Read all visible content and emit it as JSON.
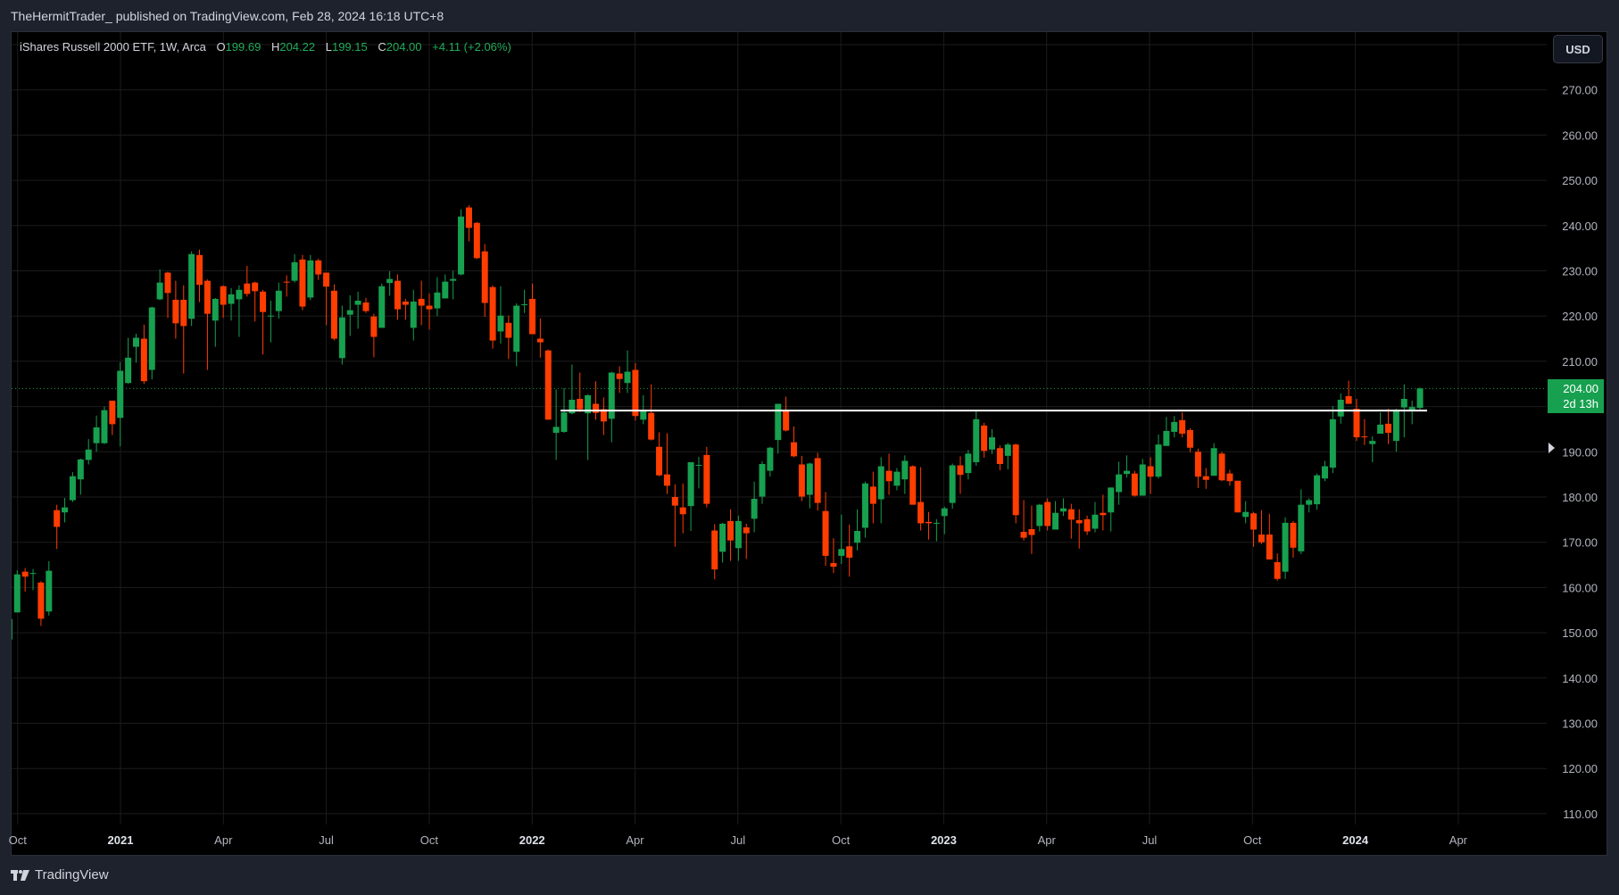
{
  "header": {
    "published": "TheHermitTrader_ published on TradingView.com, Feb 28, 2024 16:18 UTC+8"
  },
  "legend": {
    "symbol": "iShares Russell 2000 ETF, 1W, Arca",
    "o_label": "O",
    "o": "199.69",
    "h_label": "H",
    "h": "204.22",
    "l_label": "L",
    "l": "199.15",
    "c_label": "C",
    "c": "204.00",
    "change": "+4.11 (+2.06%)"
  },
  "currency_button": "USD",
  "last_price": {
    "price": "204.00",
    "countdown": "2d 13h"
  },
  "footer": {
    "brand": "TradingView"
  },
  "colors": {
    "up": "#17a04f",
    "down": "#ff3d00",
    "background": "#000000",
    "frame": "#1e222d"
  },
  "chart_data": {
    "type": "candlestick",
    "title": "iShares Russell 2000 ETF, 1W, Arca",
    "interval": "1W",
    "ylim": [
      105,
      280
    ],
    "y_ticks": [
      270,
      260,
      250,
      240,
      230,
      220,
      210,
      200,
      190,
      180,
      170,
      160,
      150,
      140,
      130,
      120,
      110
    ],
    "y_tick_labels": [
      "270.00",
      "260.00",
      "250.00",
      "240.00",
      "230.00",
      "220.00",
      "210.00",
      "200.00",
      "190.00",
      "180.00",
      "170.00",
      "160.00",
      "150.00",
      "140.00",
      "130.00",
      "120.00",
      "110.00"
    ],
    "x_labels": [
      {
        "text": "Oct",
        "major": false
      },
      {
        "text": "2021",
        "major": true
      },
      {
        "text": "Apr",
        "major": false
      },
      {
        "text": "Jul",
        "major": false
      },
      {
        "text": "Oct",
        "major": false
      },
      {
        "text": "2022",
        "major": true
      },
      {
        "text": "Apr",
        "major": false
      },
      {
        "text": "Jul",
        "major": false
      },
      {
        "text": "Oct",
        "major": false
      },
      {
        "text": "2023",
        "major": true
      },
      {
        "text": "Apr",
        "major": false
      },
      {
        "text": "Jul",
        "major": false
      },
      {
        "text": "Oct",
        "major": false
      },
      {
        "text": "2024",
        "major": true
      },
      {
        "text": "Apr",
        "major": false
      }
    ],
    "horizontal_line_level": 199.1,
    "last_price_line": 204.0,
    "ohlc_columns": [
      "open",
      "high",
      "low",
      "close"
    ],
    "ohlc": [
      [
        148.5,
        153.2,
        148.2,
        153.0
      ],
      [
        154.5,
        163.8,
        154.5,
        162.9
      ],
      [
        163.5,
        164.3,
        159.1,
        162.4
      ],
      [
        163.0,
        164.1,
        159.4,
        163.2
      ],
      [
        161.1,
        161.4,
        151.5,
        153.1
      ],
      [
        154.7,
        165.8,
        153.8,
        163.7
      ],
      [
        177.1,
        178.3,
        168.5,
        173.4
      ],
      [
        176.6,
        179.8,
        174.4,
        177.7
      ],
      [
        179.3,
        185.5,
        178.9,
        184.6
      ],
      [
        183.9,
        188.5,
        180.5,
        188.3
      ],
      [
        188.2,
        192.8,
        187.2,
        190.5
      ],
      [
        191.9,
        198.0,
        190.0,
        195.4
      ],
      [
        191.9,
        200.0,
        191.7,
        199.2
      ],
      [
        201.3,
        201.3,
        193.7,
        196.1
      ],
      [
        197.5,
        209.8,
        191.2,
        207.9
      ],
      [
        205.2,
        215.2,
        205.0,
        210.8
      ],
      [
        213.2,
        216.1,
        209.7,
        215.2
      ],
      [
        215.0,
        218.1,
        205.0,
        205.6
      ],
      [
        208.1,
        222.1,
        206.0,
        221.9
      ],
      [
        223.7,
        230.3,
        223.5,
        227.4
      ],
      [
        229.6,
        229.8,
        219.6,
        225.1
      ],
      [
        223.6,
        227.8,
        215.0,
        218.4
      ],
      [
        223.6,
        226.8,
        207.3,
        217.8
      ],
      [
        219.4,
        234.3,
        217.8,
        233.7
      ],
      [
        233.5,
        234.7,
        223.1,
        226.9
      ],
      [
        227.8,
        228.1,
        208.1,
        220.5
      ],
      [
        219.0,
        224.0,
        213.2,
        223.8
      ],
      [
        226.6,
        226.8,
        219.6,
        222.5
      ],
      [
        222.7,
        226.2,
        219.0,
        224.8
      ],
      [
        223.7,
        226.8,
        215.4,
        225.8
      ],
      [
        227.2,
        231.1,
        224.3,
        224.9
      ],
      [
        227.4,
        227.6,
        218.8,
        225.5
      ],
      [
        225.4,
        225.8,
        211.5,
        220.9
      ],
      [
        220.0,
        223.4,
        214.2,
        220.1
      ],
      [
        221.1,
        227.4,
        219.4,
        225.6
      ],
      [
        227.6,
        229.0,
        224.3,
        227.4
      ],
      [
        227.8,
        233.7,
        227.4,
        231.9
      ],
      [
        232.5,
        233.5,
        221.3,
        222.1
      ],
      [
        224.1,
        233.5,
        223.5,
        232.3
      ],
      [
        232.3,
        232.7,
        228.0,
        229.2
      ],
      [
        229.6,
        229.6,
        218.0,
        226.5
      ],
      [
        225.6,
        227.0,
        214.6,
        215.0
      ],
      [
        210.7,
        222.3,
        209.3,
        219.7
      ],
      [
        220.3,
        224.6,
        215.6,
        221.3
      ],
      [
        222.5,
        225.4,
        217.2,
        223.4
      ],
      [
        223.0,
        224.0,
        220.7,
        221.1
      ],
      [
        219.9,
        220.5,
        210.9,
        215.4
      ],
      [
        217.4,
        227.2,
        217.4,
        226.6
      ],
      [
        227.3,
        229.9,
        224.5,
        228.2
      ],
      [
        227.8,
        229.2,
        219.2,
        221.5
      ],
      [
        223.2,
        223.8,
        219.2,
        222.5
      ],
      [
        217.4,
        225.8,
        214.6,
        223.2
      ],
      [
        223.8,
        227.8,
        218.0,
        222.3
      ],
      [
        222.3,
        225.0,
        217.0,
        221.5
      ],
      [
        221.7,
        228.6,
        220.0,
        225.2
      ],
      [
        223.9,
        229.2,
        223.9,
        227.6
      ],
      [
        227.8,
        230.0,
        223.7,
        228.2
      ],
      [
        229.2,
        243.6,
        229.0,
        242.0
      ],
      [
        244.0,
        244.5,
        236.5,
        239.5
      ],
      [
        240.6,
        240.8,
        232.6,
        232.8
      ],
      [
        234.3,
        235.9,
        219.8,
        222.9
      ],
      [
        226.4,
        226.8,
        212.8,
        214.6
      ],
      [
        216.6,
        226.6,
        213.9,
        220.1
      ],
      [
        218.5,
        220.1,
        210.5,
        215.2
      ],
      [
        212.1,
        222.8,
        208.9,
        222.3
      ],
      [
        222.5,
        225.8,
        220.7,
        222.6
      ],
      [
        223.8,
        227.2,
        216.0,
        216.0
      ],
      [
        215.0,
        219.5,
        210.8,
        214.2
      ],
      [
        212.4,
        212.6,
        197.1,
        197.1
      ],
      [
        194.2,
        203.8,
        188.2,
        195.5
      ],
      [
        194.4,
        204.1,
        194.2,
        198.7
      ],
      [
        198.5,
        209.3,
        198.3,
        201.5
      ],
      [
        201.7,
        207.5,
        198.8,
        199.4
      ],
      [
        198.5,
        202.7,
        188.2,
        202.5
      ],
      [
        200.6,
        205.6,
        197.1,
        198.6
      ],
      [
        199.4,
        202.0,
        193.7,
        196.7
      ],
      [
        197.3,
        207.7,
        192.1,
        207.5
      ],
      [
        207.3,
        208.9,
        203.0,
        206.1
      ],
      [
        205.2,
        212.4,
        203.0,
        207.7
      ],
      [
        208.1,
        209.6,
        196.9,
        197.9
      ],
      [
        197.1,
        202.5,
        196.1,
        199.2
      ],
      [
        198.6,
        204.9,
        192.5,
        192.7
      ],
      [
        191.1,
        194.3,
        184.6,
        184.8
      ],
      [
        185.0,
        194.1,
        180.7,
        182.5
      ],
      [
        180.0,
        182.8,
        169.0,
        178.1
      ],
      [
        177.7,
        183.0,
        172.0,
        176.2
      ],
      [
        178.0,
        187.7,
        172.5,
        187.7
      ],
      [
        187.0,
        188.9,
        181.9,
        187.1
      ],
      [
        189.3,
        191.1,
        177.7,
        178.5
      ],
      [
        172.6,
        174.0,
        161.8,
        164.0
      ],
      [
        167.9,
        174.3,
        165.5,
        174.1
      ],
      [
        174.7,
        177.3,
        165.9,
        170.4
      ],
      [
        168.7,
        175.9,
        165.9,
        174.7
      ],
      [
        173.3,
        174.1,
        166.3,
        172.0
      ],
      [
        175.2,
        183.4,
        172.2,
        179.6
      ],
      [
        180.1,
        187.9,
        178.5,
        187.3
      ],
      [
        185.8,
        191.1,
        184.5,
        190.9
      ],
      [
        192.6,
        200.6,
        189.6,
        200.6
      ],
      [
        199.0,
        202.2,
        194.5,
        194.7
      ],
      [
        192.1,
        195.6,
        188.8,
        189.0
      ],
      [
        187.2,
        189.1,
        179.1,
        180.1
      ],
      [
        180.5,
        187.6,
        177.5,
        187.4
      ],
      [
        188.6,
        189.8,
        177.0,
        178.7
      ],
      [
        176.9,
        181.1,
        164.8,
        167.0
      ],
      [
        165.4,
        170.9,
        163.2,
        164.6
      ],
      [
        167.0,
        176.1,
        165.2,
        168.5
      ],
      [
        169.1,
        173.9,
        162.4,
        166.6
      ],
      [
        169.9,
        177.3,
        168.2,
        172.5
      ],
      [
        173.2,
        183.4,
        171.0,
        183.0
      ],
      [
        182.3,
        185.6,
        174.2,
        178.5
      ],
      [
        179.5,
        188.8,
        174.2,
        186.8
      ],
      [
        185.8,
        189.6,
        180.5,
        183.5
      ],
      [
        182.5,
        186.4,
        181.5,
        185.6
      ],
      [
        183.9,
        189.2,
        180.7,
        188.0
      ],
      [
        186.8,
        187.0,
        178.3,
        178.3
      ],
      [
        178.9,
        186.6,
        172.6,
        174.2
      ],
      [
        174.5,
        176.7,
        170.6,
        174.2
      ],
      [
        174.2,
        175.1,
        170.2,
        174.3
      ],
      [
        175.8,
        177.9,
        171.8,
        177.5
      ],
      [
        178.7,
        187.4,
        177.4,
        187.0
      ],
      [
        187.0,
        189.0,
        180.7,
        184.9
      ],
      [
        185.3,
        190.4,
        183.9,
        189.6
      ],
      [
        187.7,
        199.3,
        186.9,
        197.2
      ],
      [
        195.8,
        196.4,
        188.7,
        190.2
      ],
      [
        190.5,
        195.0,
        189.5,
        193.2
      ],
      [
        190.8,
        191.4,
        185.9,
        187.3
      ],
      [
        189.1,
        192.0,
        186.1,
        191.6
      ],
      [
        191.6,
        191.8,
        174.2,
        176.0
      ],
      [
        172.3,
        179.3,
        170.4,
        171.0
      ],
      [
        172.9,
        178.1,
        167.4,
        171.6
      ],
      [
        173.6,
        178.5,
        172.4,
        178.3
      ],
      [
        178.9,
        179.7,
        172.6,
        173.6
      ],
      [
        172.8,
        179.1,
        172.8,
        176.5
      ],
      [
        176.8,
        179.7,
        175.8,
        177.5
      ],
      [
        177.3,
        178.5,
        170.8,
        175.0
      ],
      [
        174.9,
        177.3,
        168.6,
        174.2
      ],
      [
        175.1,
        175.9,
        171.6,
        172.4
      ],
      [
        173.0,
        178.9,
        172.2,
        176.1
      ],
      [
        176.5,
        180.5,
        172.6,
        176.0
      ],
      [
        176.6,
        182.1,
        172.4,
        182.1
      ],
      [
        181.1,
        187.8,
        178.3,
        185.0
      ],
      [
        185.1,
        189.2,
        184.3,
        185.8
      ],
      [
        185.2,
        185.8,
        180.1,
        180.3
      ],
      [
        180.3,
        188.4,
        180.3,
        187.2
      ],
      [
        186.8,
        188.8,
        180.7,
        184.5
      ],
      [
        184.5,
        193.8,
        184.1,
        191.6
      ],
      [
        191.3,
        197.7,
        191.3,
        194.6
      ],
      [
        194.4,
        197.9,
        193.2,
        196.6
      ],
      [
        197.0,
        198.7,
        193.2,
        194.0
      ],
      [
        194.8,
        195.2,
        189.9,
        190.9
      ],
      [
        190.0,
        190.7,
        182.0,
        184.5
      ],
      [
        184.6,
        186.4,
        181.8,
        183.8
      ],
      [
        184.7,
        191.9,
        184.7,
        190.8
      ],
      [
        189.6,
        190.0,
        183.5,
        183.7
      ],
      [
        185.2,
        186.0,
        182.5,
        183.5
      ],
      [
        183.6,
        183.6,
        176.6,
        176.6
      ],
      [
        175.6,
        179.1,
        174.2,
        176.7
      ],
      [
        176.4,
        176.7,
        169.0,
        172.8
      ],
      [
        171.7,
        177.1,
        169.6,
        170.0
      ],
      [
        171.7,
        176.3,
        166.2,
        166.2
      ],
      [
        165.6,
        167.5,
        161.5,
        161.9
      ],
      [
        163.5,
        175.5,
        161.9,
        174.3
      ],
      [
        174.3,
        174.7,
        166.6,
        168.8
      ],
      [
        168.0,
        181.7,
        167.4,
        178.3
      ],
      [
        178.3,
        179.7,
        176.6,
        179.3
      ],
      [
        178.4,
        185.2,
        177.2,
        184.8
      ],
      [
        184.1,
        188.0,
        183.5,
        186.8
      ],
      [
        186.5,
        200.1,
        185.3,
        197.2
      ],
      [
        197.8,
        202.9,
        196.2,
        201.5
      ],
      [
        202.3,
        205.7,
        200.6,
        200.6
      ],
      [
        199.5,
        201.7,
        192.4,
        193.2
      ],
      [
        193.4,
        197.2,
        191.5,
        193.2
      ],
      [
        191.7,
        193.4,
        187.7,
        192.4
      ],
      [
        194.0,
        198.7,
        194.0,
        196.0
      ],
      [
        196.2,
        199.5,
        191.7,
        194.2
      ],
      [
        192.4,
        199.5,
        190.0,
        199.3
      ],
      [
        199.8,
        204.9,
        193.2,
        201.7
      ],
      [
        199.0,
        201.3,
        196.1,
        199.9
      ],
      [
        199.69,
        204.22,
        199.15,
        204.0
      ]
    ]
  }
}
